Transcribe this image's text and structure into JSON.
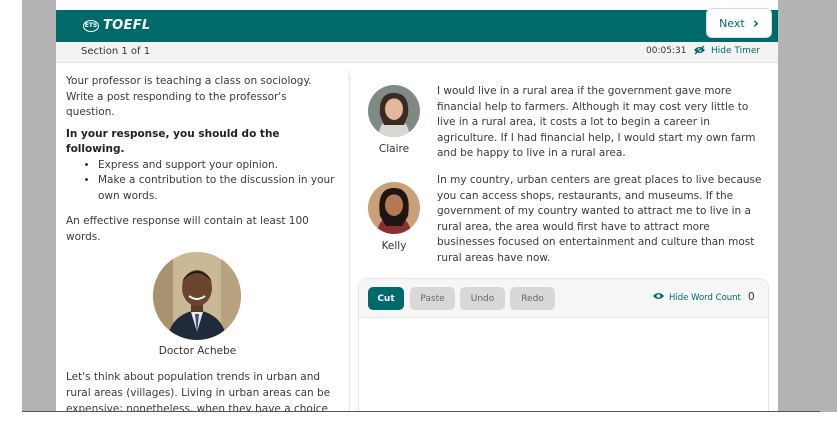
{
  "header": {
    "brand_badge": "ETS",
    "brand_name": "TOEFL",
    "next_label": "Next"
  },
  "section": {
    "label": "Section 1 of 1",
    "timer": "00:05:31",
    "hide_timer_label": "Hide Timer"
  },
  "prompt": {
    "intro": "Your professor is teaching a class on sociology. Write a post responding to the professor's question.",
    "instructions_heading": "In your response, you should do the following.",
    "bullets": [
      "Express and support your opinion.",
      "Make a contribution to the discussion in your own words."
    ],
    "requirement": "An effective response will contain at least 100 words.",
    "professor_name": "Doctor Achebe",
    "professor_text": "Let's think about population trends in urban and rural areas (villages). Living in urban areas can be expensive; nonetheless, when they have a choice"
  },
  "students": [
    {
      "name": "Claire",
      "text": "I would live in a rural area if the government gave more financial help to farmers. Although it may cost very little to live in a rural area, it costs a lot to begin a career in agriculture. If I had financial help, I would start my own farm and be happy to live in a rural area."
    },
    {
      "name": "Kelly",
      "text": "In my country, urban centers are great places to live because you can access shops, restaurants, and museums. If the government of my country wanted to attract me to live in a rural area, the area would first have to attract more businesses focused on entertainment and culture than most rural areas have now."
    }
  ],
  "editor": {
    "cut": "Cut",
    "paste": "Paste",
    "undo": "Undo",
    "redo": "Redo",
    "hide_word_count": "Hide Word Count",
    "word_count": "0"
  },
  "colors": {
    "accent": "#006a6a"
  }
}
